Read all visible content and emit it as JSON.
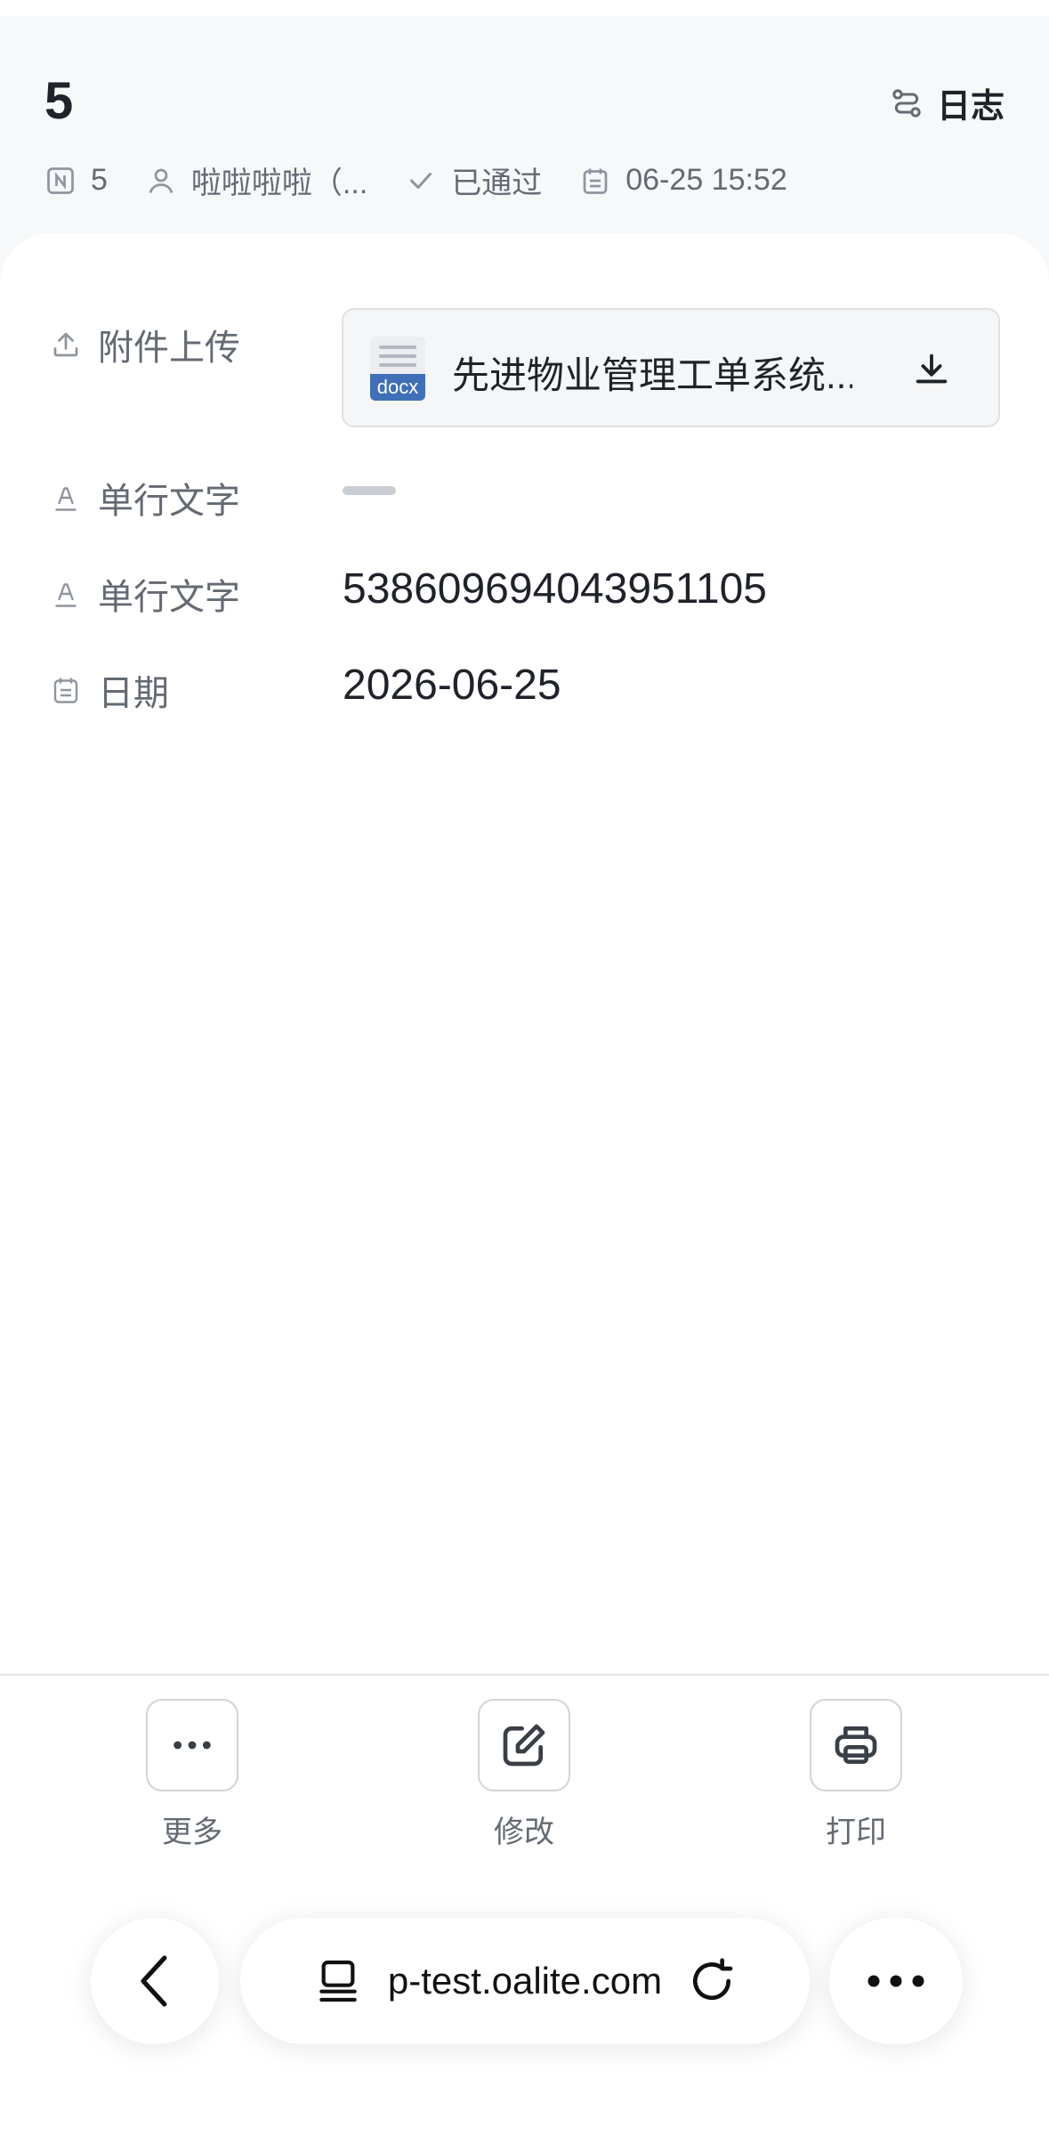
{
  "header": {
    "title": "5",
    "log_label": "日志",
    "meta": {
      "number": "5",
      "creator": "啦啦啦啦（...",
      "status": "已通过",
      "datetime": "06-25 15:52"
    }
  },
  "fields": [
    {
      "label": "附件上传",
      "icon": "upload-icon",
      "file_name": "先进物业管理工单系统...",
      "file_type": "docx"
    },
    {
      "label": "单行文字",
      "icon": "text-field-icon",
      "value": ""
    },
    {
      "label": "单行文字",
      "icon": "text-field-icon",
      "value": "538609694043951105"
    },
    {
      "label": "日期",
      "icon": "calendar-icon",
      "value": "2026-06-25"
    }
  ],
  "toolbar": {
    "more_label": "更多",
    "edit_label": "修改",
    "print_label": "打印"
  },
  "browser": {
    "url": "p-test.oalite.com"
  },
  "colors": {
    "accent_file": "#3f6fb6",
    "text_primary": "#1f2329",
    "text_secondary": "#646a73"
  }
}
